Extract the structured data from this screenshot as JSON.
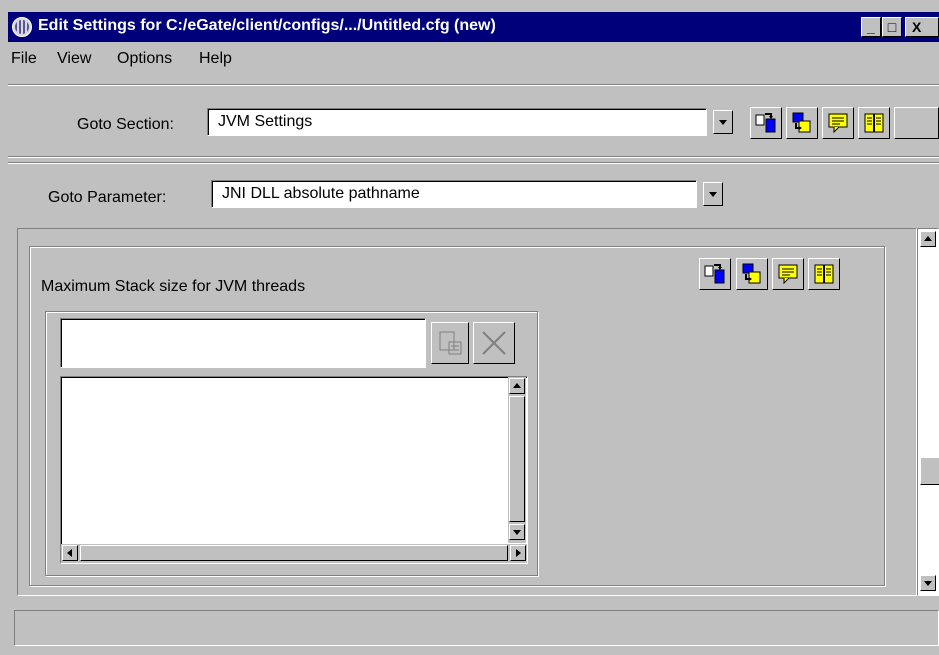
{
  "window": {
    "title": "Edit Settings for C:/eGate/client/configs/.../Untitled.cfg (new)",
    "controls": {
      "minimize": "_",
      "maximize": "□",
      "close": "X"
    }
  },
  "menu": [
    "File",
    "View",
    "Options",
    "Help"
  ],
  "goto_section": {
    "label": "Goto Section:",
    "value": "JVM Settings"
  },
  "goto_parameter": {
    "label": "Goto Parameter:",
    "value": "JNI DLL absolute pathname"
  },
  "toolbar_icons": [
    "load-icon",
    "save-icon",
    "comment-icon",
    "book-icon"
  ],
  "parameter_panel": {
    "title": "Maximum Stack size for JVM threads",
    "input_value": "",
    "list_items": [],
    "action_icons": [
      "add-to-list-icon",
      "delete-x-icon"
    ]
  },
  "status_bar": {
    "text": ""
  },
  "colors": {
    "title_bg": "#00007b",
    "face": "#c0c0c0",
    "field_bg": "#ffffff",
    "icon_yellow": "#ffff00",
    "icon_blue": "#0000ff"
  }
}
